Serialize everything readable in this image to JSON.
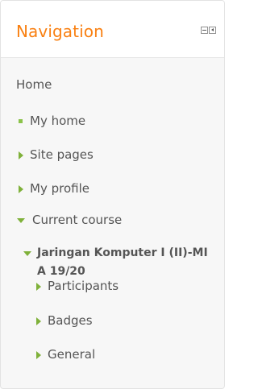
{
  "block": {
    "title": "Navigation",
    "controls": [
      {
        "name": "hide-block-icon"
      },
      {
        "name": "dock-block-icon"
      }
    ]
  },
  "nav": {
    "home": "Home",
    "my_home": "My home",
    "site_pages": "Site pages",
    "my_profile": "My profile",
    "current_course": "Current course",
    "course": "Jaringan Komputer I (II)-MI A 19/20",
    "participants": "Participants",
    "badges": "Badges",
    "general": "General"
  },
  "colors": {
    "title": "#f98012",
    "icon_green": "#7fb13a",
    "text": "#555555"
  }
}
